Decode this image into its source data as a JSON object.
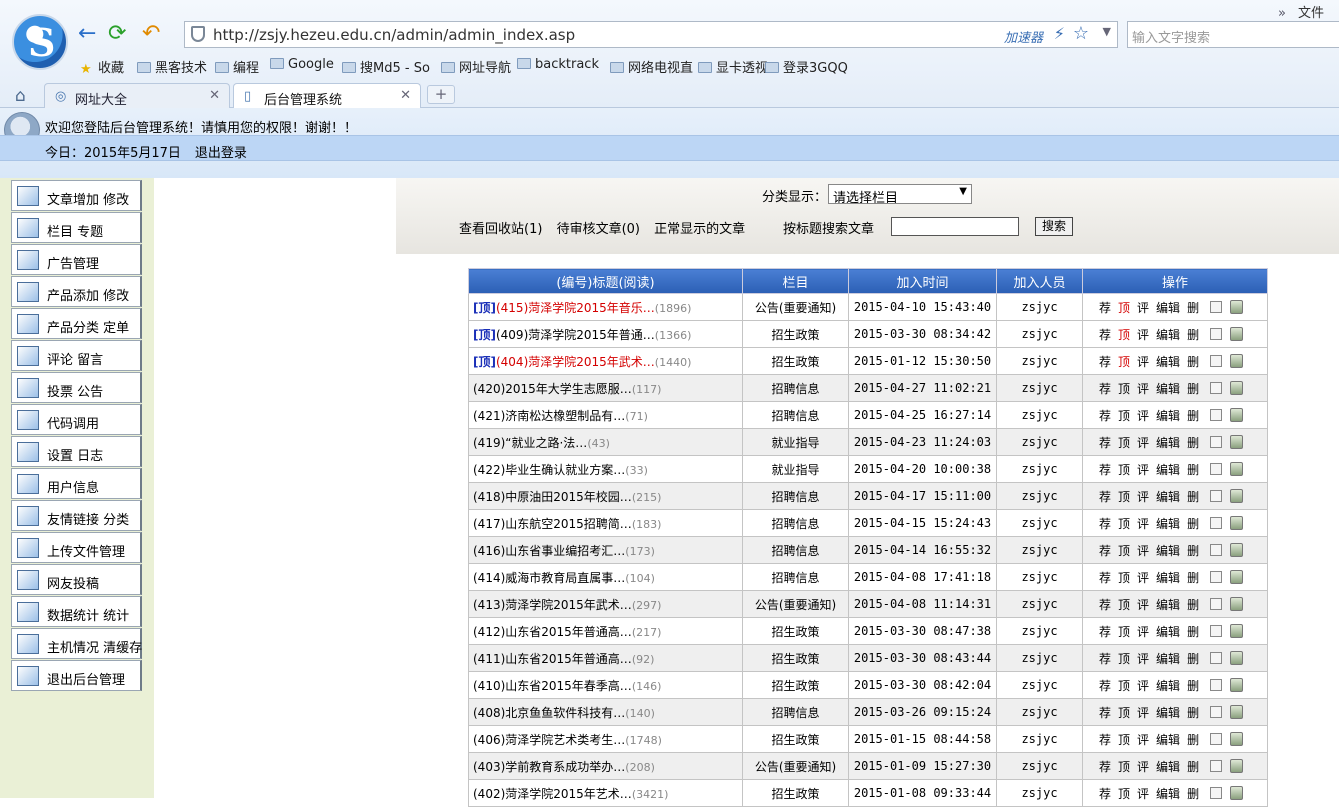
{
  "browser": {
    "url": "http://zsjy.hezeu.edu.cn/admin/admin_index.asp",
    "accelerator": "加速器",
    "search_placeholder": "输入文字搜索",
    "top_menu": "文件",
    "bookmarks": [
      "收藏",
      "黑客技术",
      "编程",
      "Google",
      "搜Md5 - So",
      "网址导航",
      "backtrack",
      "网络电视直",
      "显卡透视",
      "登录3GQQ"
    ],
    "tabs": [
      "网址大全",
      "后台管理系统"
    ]
  },
  "admin": {
    "welcome": "欢迎您登陆后台管理系统！请慎用您的权限！谢谢！！",
    "today": "今日：2015年5月17日",
    "logout": "退出登录"
  },
  "sidebar": [
    "文章增加 修改",
    "栏目 专题",
    "广告管理",
    "产品添加 修改",
    "产品分类 定单",
    "评论 留言",
    "投票 公告",
    "代码调用",
    "设置 日志",
    "用户信息",
    "友情链接 分类",
    "上传文件管理",
    "网友投稿",
    "数据统计 统计",
    "主机情况 清缓存",
    "退出后台管理"
  ],
  "filter": {
    "category_label": "分类显示：",
    "category_value": "请选择栏目",
    "recycle": "查看回收站(1)",
    "pending": "待审核文章(0)",
    "normal": "正常显示的文章",
    "search_label": "按标题搜索文章",
    "search_button": "搜索"
  },
  "table": {
    "headers": [
      "(编号)标题(阅读)",
      "栏目",
      "加入时间",
      "加入人员",
      "操作"
    ],
    "top_tag": "[顶]",
    "actions": [
      "荐",
      "顶",
      "评",
      "编辑",
      "删"
    ],
    "rows": [
      {
        "top": true,
        "red": true,
        "title": "(415)菏泽学院2015年音乐…",
        "reads": "(1896)",
        "cat": "公告(重要通知)",
        "time": "2015-04-10 15:43:40",
        "user": "zsjyc"
      },
      {
        "top": true,
        "red": false,
        "title": "(409)菏泽学院2015年普通…",
        "reads": "(1366)",
        "cat": "招生政策",
        "time": "2015-03-30 08:34:42",
        "user": "zsjyc"
      },
      {
        "top": true,
        "red": true,
        "title": "(404)菏泽学院2015年武术…",
        "reads": "(1440)",
        "cat": "招生政策",
        "time": "2015-01-12 15:30:50",
        "user": "zsjyc"
      },
      {
        "top": false,
        "red": false,
        "title": "(420)2015年大学生志愿服…",
        "reads": "(117)",
        "cat": "招聘信息",
        "time": "2015-04-27 11:02:21",
        "user": "zsjyc"
      },
      {
        "top": false,
        "red": false,
        "title": "(421)济南松达橡塑制品有…",
        "reads": "(71)",
        "cat": "招聘信息",
        "time": "2015-04-25 16:27:14",
        "user": "zsjyc"
      },
      {
        "top": false,
        "red": false,
        "title": "(419)“就业之路·法…",
        "reads": "(43)",
        "cat": "就业指导",
        "time": "2015-04-23 11:24:03",
        "user": "zsjyc"
      },
      {
        "top": false,
        "red": false,
        "title": "(422)毕业生确认就业方案…",
        "reads": "(33)",
        "cat": "就业指导",
        "time": "2015-04-20 10:00:38",
        "user": "zsjyc"
      },
      {
        "top": false,
        "red": false,
        "title": "(418)中原油田2015年校园…",
        "reads": "(215)",
        "cat": "招聘信息",
        "time": "2015-04-17 15:11:00",
        "user": "zsjyc"
      },
      {
        "top": false,
        "red": false,
        "title": "(417)山东航空2015招聘简…",
        "reads": "(183)",
        "cat": "招聘信息",
        "time": "2015-04-15 15:24:43",
        "user": "zsjyc"
      },
      {
        "top": false,
        "red": false,
        "title": "(416)山东省事业编招考汇…",
        "reads": "(173)",
        "cat": "招聘信息",
        "time": "2015-04-14 16:55:32",
        "user": "zsjyc"
      },
      {
        "top": false,
        "red": false,
        "title": "(414)威海市教育局直属事…",
        "reads": "(104)",
        "cat": "招聘信息",
        "time": "2015-04-08 17:41:18",
        "user": "zsjyc"
      },
      {
        "top": false,
        "red": false,
        "title": "(413)菏泽学院2015年武术…",
        "reads": "(297)",
        "cat": "公告(重要通知)",
        "time": "2015-04-08 11:14:31",
        "user": "zsjyc"
      },
      {
        "top": false,
        "red": false,
        "title": "(412)山东省2015年普通高…",
        "reads": "(217)",
        "cat": "招生政策",
        "time": "2015-03-30 08:47:38",
        "user": "zsjyc"
      },
      {
        "top": false,
        "red": false,
        "title": "(411)山东省2015年普通高…",
        "reads": "(92)",
        "cat": "招生政策",
        "time": "2015-03-30 08:43:44",
        "user": "zsjyc"
      },
      {
        "top": false,
        "red": false,
        "title": "(410)山东省2015年春季高…",
        "reads": "(146)",
        "cat": "招生政策",
        "time": "2015-03-30 08:42:04",
        "user": "zsjyc"
      },
      {
        "top": false,
        "red": false,
        "title": "(408)北京鱼鱼软件科技有…",
        "reads": "(140)",
        "cat": "招聘信息",
        "time": "2015-03-26 09:15:24",
        "user": "zsjyc"
      },
      {
        "top": false,
        "red": false,
        "title": "(406)菏泽学院艺术类考生…",
        "reads": "(1748)",
        "cat": "招生政策",
        "time": "2015-01-15 08:44:58",
        "user": "zsjyc"
      },
      {
        "top": false,
        "red": false,
        "title": "(403)学前教育系成功举办…",
        "reads": "(208)",
        "cat": "公告(重要通知)",
        "time": "2015-01-09 15:27:30",
        "user": "zsjyc"
      },
      {
        "top": false,
        "red": false,
        "title": "(402)菏泽学院2015年艺术…",
        "reads": "(3421)",
        "cat": "招生政策",
        "time": "2015-01-08 09:33:44",
        "user": "zsjyc"
      }
    ]
  }
}
